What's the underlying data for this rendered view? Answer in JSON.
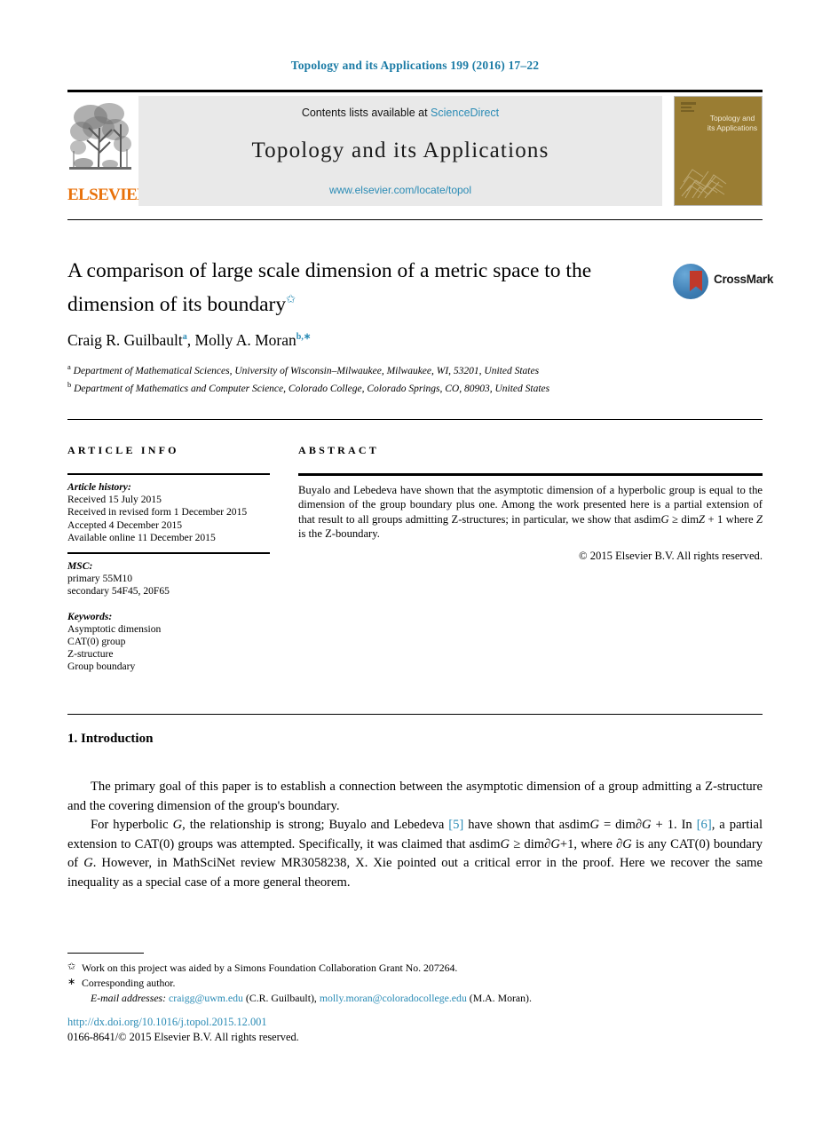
{
  "running_head": "Topology and its Applications 199 (2016) 17–22",
  "masthead": {
    "contents_prefix": "Contents lists available at ",
    "contents_link": "ScienceDirect",
    "journal_title": "Topology and its Applications",
    "journal_url": "www.elsevier.com/locate/topol",
    "publisher_wordmark": "ELSEVIER",
    "cover_title": "Topology and its Applications"
  },
  "article": {
    "title": "A comparison of large scale dimension of a metric space to the dimension of its boundary",
    "title_footnote_marker": "✩",
    "crossmark_label": "CrossMark",
    "authors": [
      {
        "name": "Craig R. Guilbault",
        "marker": "a"
      },
      {
        "name": "Molly A. Moran",
        "marker": "b,∗"
      }
    ],
    "affiliations": [
      {
        "marker": "a",
        "text": "Department of Mathematical Sciences, University of Wisconsin–Milwaukee, Milwaukee, WI, 53201, United States"
      },
      {
        "marker": "b",
        "text": "Department of Mathematics and Computer Science, Colorado College, Colorado Springs, CO, 80903, United States"
      }
    ]
  },
  "info": {
    "heading": "ARTICLE INFO",
    "history_label": "Article history:",
    "history": [
      "Received 15 July 2015",
      "Received in revised form 1 December 2015",
      "Accepted 4 December 2015",
      "Available online 11 December 2015"
    ],
    "msc_label": "MSC:",
    "msc": [
      "primary 55M10",
      "secondary 54F45, 20F65"
    ],
    "keywords_label": "Keywords:",
    "keywords": [
      "Asymptotic dimension",
      "CAT(0) group",
      "Z-structure",
      "Group boundary"
    ]
  },
  "abstract": {
    "heading": "ABSTRACT",
    "text_part1": "Buyalo and Lebedeva have shown that the asymptotic dimension of a hyperbolic group is equal to the dimension of the group boundary plus one. Among the work presented here is a partial extension of that result to all groups admitting Z-structures; in particular, we show that asdim",
    "math_g": "G",
    "math_rel": " ≥ dim",
    "math_z": "Z",
    "text_part2": " + 1 where ",
    "math_z2": "Z",
    "text_part3": " is the Z-boundary.",
    "copyright": "© 2015 Elsevier B.V. All rights reserved."
  },
  "body": {
    "section_number_title": "1. Introduction",
    "para1": "The primary goal of this paper is to establish a connection between the asymptotic dimension of a group admitting a Z-structure and the covering dimension of the group's boundary.",
    "para2_a": "For hyperbolic ",
    "para2_g1": "G",
    "para2_b": ", the relationship is strong; Buyalo and Lebedeva ",
    "para2_cite1": "[5]",
    "para2_c": " have shown that asdim",
    "para2_g2": "G",
    "para2_d": " = dim∂",
    "para2_g3": "G",
    "para2_e": " + 1. In ",
    "para2_cite2": "[6]",
    "para2_f": ", a partial extension to CAT(0) groups was attempted. Specifically, it was claimed that asdim",
    "para2_g4": "G",
    "para2_g": " ≥ dim∂",
    "para2_g5": "G",
    "para2_h": "+1, where ∂",
    "para2_g6": "G",
    "para2_i": " is any CAT(0) boundary of ",
    "para2_g7": "G",
    "para2_j": ". However, in MathSciNet review MR3058238, X. Xie pointed out a critical error in the proof. Here we recover the same inequality as a special case of a more general theorem."
  },
  "footnotes": {
    "grant_marker": "✩",
    "grant": "Work on this project was aided by a Simons Foundation Collaboration Grant No. 207264.",
    "corresponding_marker": "∗",
    "corresponding": "Corresponding author.",
    "emails_label": "E-mail addresses:",
    "email1": "craigg@uwm.edu",
    "email1_who": "(C.R. Guilbault),",
    "email2": "molly.moran@coloradocollege.edu",
    "email2_who": "(M.A. Moran)."
  },
  "imprint": {
    "doi": "http://dx.doi.org/10.1016/j.topol.2015.12.001",
    "issn_line": "0166-8641/© 2015 Elsevier B.V. All rights reserved."
  },
  "colors": {
    "link": "#2a8bb5",
    "running_head": "#1b7ba5",
    "elsevier_orange": "#e8710a",
    "cover_bg": "#9a7d33",
    "banner_bg": "#e9e9e9"
  }
}
